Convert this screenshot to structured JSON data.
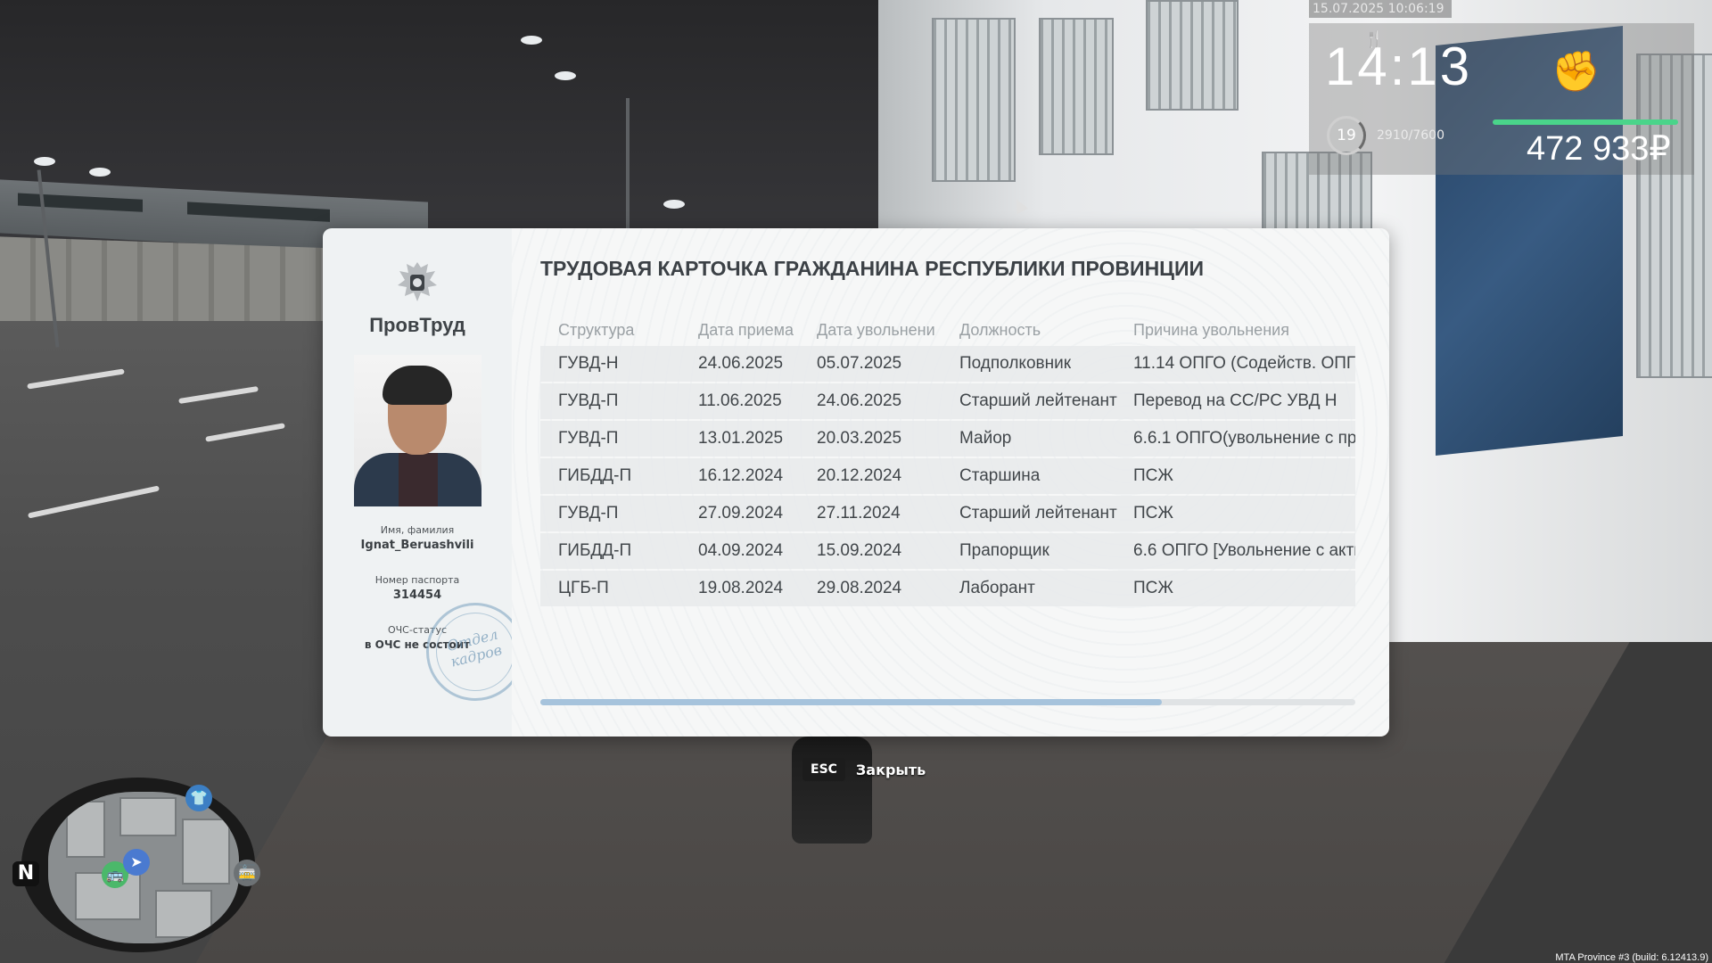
{
  "hud": {
    "datetime": "15.07.2025 10:06:19",
    "time": "14:13",
    "level": "19",
    "experience": "2910/7600",
    "money": "472 933₽",
    "hunger_icon": "fork-knife-icon",
    "fist_icon": "fist-icon"
  },
  "card": {
    "brand": "ПровТруд",
    "title": "ТРУДОВАЯ КАРТОЧКА ГРАЖДАНИНА РЕСПУБЛИКИ ПРОВИНЦИИ",
    "name_label": "Имя, фамилия",
    "name_value": "Ignat_Beruashvili",
    "passport_label": "Номер паспорта",
    "passport_value": "314454",
    "ochs_label": "ОЧС-статус",
    "ochs_value": "в ОЧС не состоит",
    "stamp_line1": "Отдел",
    "stamp_line2": "кадров",
    "columns": [
      "Структура",
      "Дата приема",
      "Дата увольнени",
      "Должность",
      "Причина увольнения"
    ],
    "rows": [
      [
        "ГУВД-Н",
        "24.06.2025",
        "05.07.2025",
        "Подполковник",
        "11.14 ОПГО (Содейств. ОПГ"
      ],
      [
        "ГУВД-П",
        "11.06.2025",
        "24.06.2025",
        "Старший лейтенант",
        "Перевод на СС/РС УВД Н"
      ],
      [
        "ГУВД-П",
        "13.01.2025",
        "20.03.2025",
        "Майор",
        "6.6.1 ОПГО(увольнение с пр"
      ],
      [
        "ГИБДД-П",
        "16.12.2024",
        "20.12.2024",
        "Старшина",
        "ПСЖ"
      ],
      [
        "ГУВД-П",
        "27.09.2024",
        "27.11.2024",
        "Старший лейтенант",
        "ПСЖ"
      ],
      [
        "ГИБДД-П",
        "04.09.2024",
        "15.09.2024",
        "Прапорщик",
        "6.6 ОПГО [Увольнение с акти"
      ],
      [
        "ЦГБ-П",
        "19.08.2024",
        "29.08.2024",
        "Лаборант",
        "ПСЖ"
      ]
    ],
    "scroll_fraction": 0.763
  },
  "close": {
    "key": "ESC",
    "label": "Закрыть"
  },
  "minimap": {
    "north": "N"
  },
  "build_info": "MTA Province #3 (build: 6.12413.9)",
  "colors": {
    "money_bar": "#4ad48a",
    "scroll_thumb": "#a6c3dc",
    "hunger": "#d6322f"
  }
}
